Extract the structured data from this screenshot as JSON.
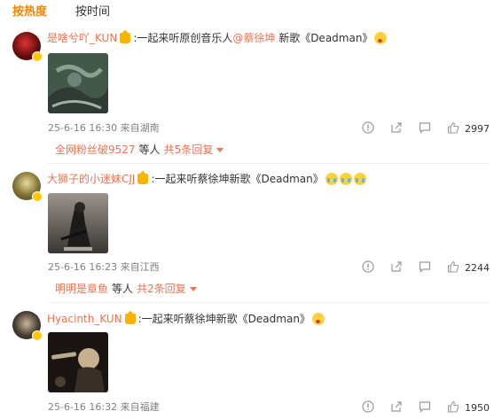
{
  "tabs": [
    {
      "label": "按热度",
      "active": true
    },
    {
      "label": "按时间",
      "active": false
    }
  ],
  "comments": [
    {
      "username": "是啥兮吖_KUN",
      "text_before": ":一起来听原创音乐人",
      "mention": "@蔡徐坤",
      "text_after": " 新歌《Deadman》",
      "emojis": [
        "wow"
      ],
      "date": "25-6-16 16:30",
      "location": "来自湖南",
      "likes": "2997",
      "reply_name": "全网粉丝破9527",
      "reply_etc": "等人",
      "reply_count": "共5条回复"
    },
    {
      "username": "大狮子的小迷妹CJJ",
      "text_before": ":一起来听蔡徐坤新歌《Deadman》",
      "mention": "",
      "text_after": "",
      "emojis": [
        "cry",
        "cry",
        "cry"
      ],
      "date": "25-6-16 16:23",
      "location": "来自江西",
      "likes": "2244",
      "reply_name": "明明是章鱼",
      "reply_etc": "等人",
      "reply_count": "共2条回复"
    },
    {
      "username": "Hyacinth_KUN",
      "text_before": ":一起来听蔡徐坤新歌《Deadman》",
      "mention": "",
      "text_after": "",
      "emojis": [
        "wow"
      ],
      "date": "25-6-16 16:32",
      "location": "来自福建",
      "likes": "1950"
    }
  ],
  "colors": {
    "accent": "#ff8200",
    "username": "#eb7350",
    "meta": "#808080"
  },
  "icons": [
    "vip-badge-icon",
    "crown-icon",
    "report-icon",
    "share-icon",
    "comment-icon",
    "like-icon",
    "chevron-down-icon"
  ]
}
